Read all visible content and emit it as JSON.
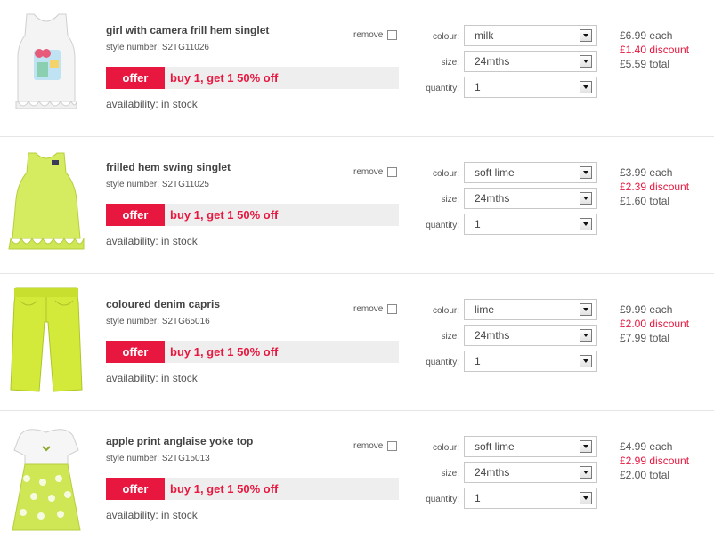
{
  "items": [
    {
      "name": "girl with camera frill hem singlet",
      "style_label": "style number:",
      "style_number": "S2TG11026",
      "offer_tag": "offer",
      "offer_text": "buy 1, get 1 50% off",
      "availability": "availability: in stock",
      "remove_label": "remove",
      "colour_label": "colour:",
      "colour": "milk",
      "size_label": "size:",
      "size": "24mths",
      "quantity_label": "quantity:",
      "quantity": "1",
      "each": "£6.99 each",
      "discount": "£1.40 discount",
      "total": "£5.59 total",
      "icon": "white-singlet-image"
    },
    {
      "name": "frilled hem swing singlet",
      "style_label": "style number:",
      "style_number": "S2TG11025",
      "offer_tag": "offer",
      "offer_text": "buy 1, get 1 50% off",
      "availability": "availability: in stock",
      "remove_label": "remove",
      "colour_label": "colour:",
      "colour": "soft lime",
      "size_label": "size:",
      "size": "24mths",
      "quantity_label": "quantity:",
      "quantity": "1",
      "each": "£3.99 each",
      "discount": "£2.39 discount",
      "total": "£1.60 total",
      "icon": "lime-singlet-image"
    },
    {
      "name": "coloured denim capris",
      "style_label": "style number:",
      "style_number": "S2TG65016",
      "offer_tag": "offer",
      "offer_text": "buy 1, get 1 50% off",
      "availability": "availability: in stock",
      "remove_label": "remove",
      "colour_label": "colour:",
      "colour": "lime",
      "size_label": "size:",
      "size": "24mths",
      "quantity_label": "quantity:",
      "quantity": "1",
      "each": "£9.99 each",
      "discount": "£2.00 discount",
      "total": "£7.99 total",
      "icon": "lime-capris-image"
    },
    {
      "name": "apple print anglaise yoke top",
      "style_label": "style number:",
      "style_number": "S2TG15013",
      "offer_tag": "offer",
      "offer_text": "buy 1, get 1 50% off",
      "availability": "availability: in stock",
      "remove_label": "remove",
      "colour_label": "colour:",
      "colour": "soft lime",
      "size_label": "size:",
      "size": "24mths",
      "quantity_label": "quantity:",
      "quantity": "1",
      "each": "£4.99 each",
      "discount": "£2.99 discount",
      "total": "£2.00 total",
      "icon": "apple-print-top-image"
    }
  ],
  "colors": {
    "offer_red": "#e8173f",
    "lime": "#d2ea5a",
    "text": "#444444"
  }
}
